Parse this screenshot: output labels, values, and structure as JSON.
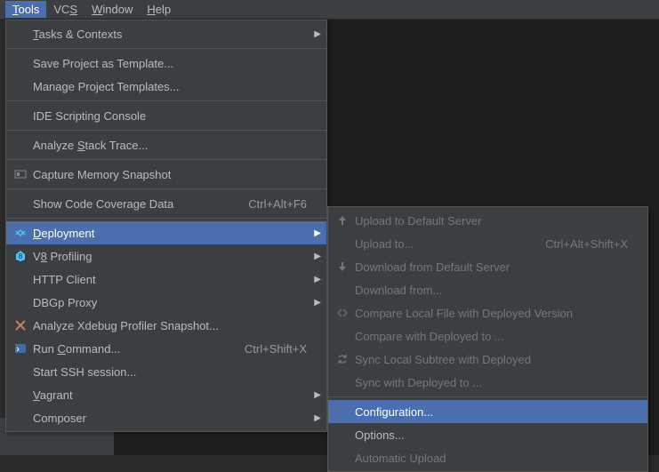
{
  "menubar": {
    "tools": "Tools",
    "vcs": "VCS",
    "window": "Window",
    "help": "Help"
  },
  "toolsMenu": {
    "tasks": "Tasks & Contexts",
    "saveTemplate": "Save Project as Template...",
    "manageTemplates": "Manage Project Templates...",
    "ideScripting": "IDE Scripting Console",
    "analyzeStack": "Analyze Stack Trace...",
    "captureMemory": "Capture Memory Snapshot",
    "showCoverage": "Show Code Coverage Data",
    "showCoverageShortcut": "Ctrl+Alt+F6",
    "deployment": "Deployment",
    "v8": "V8 Profiling",
    "httpClient": "HTTP Client",
    "dbgpProxy": "DBGp Proxy",
    "analyzeXdebug": "Analyze Xdebug Profiler Snapshot...",
    "runCommand": "Run Command...",
    "runCommandShortcut": "Ctrl+Shift+X",
    "startSSH": "Start SSH session...",
    "vagrant": "Vagrant",
    "composer": "Composer"
  },
  "deployMenu": {
    "uploadDefault": "Upload to Default Server",
    "uploadTo": "Upload to...",
    "uploadToShortcut": "Ctrl+Alt+Shift+X",
    "downloadDefault": "Download from Default Server",
    "downloadFrom": "Download from...",
    "compareLocal": "Compare Local File with Deployed Version",
    "compareDeployed": "Compare with Deployed to ...",
    "syncLocal": "Sync Local Subtree with Deployed",
    "syncDeployed": "Sync with Deployed to ...",
    "configuration": "Configuration...",
    "options": "Options...",
    "automaticUpload": "Automatic Upload"
  }
}
